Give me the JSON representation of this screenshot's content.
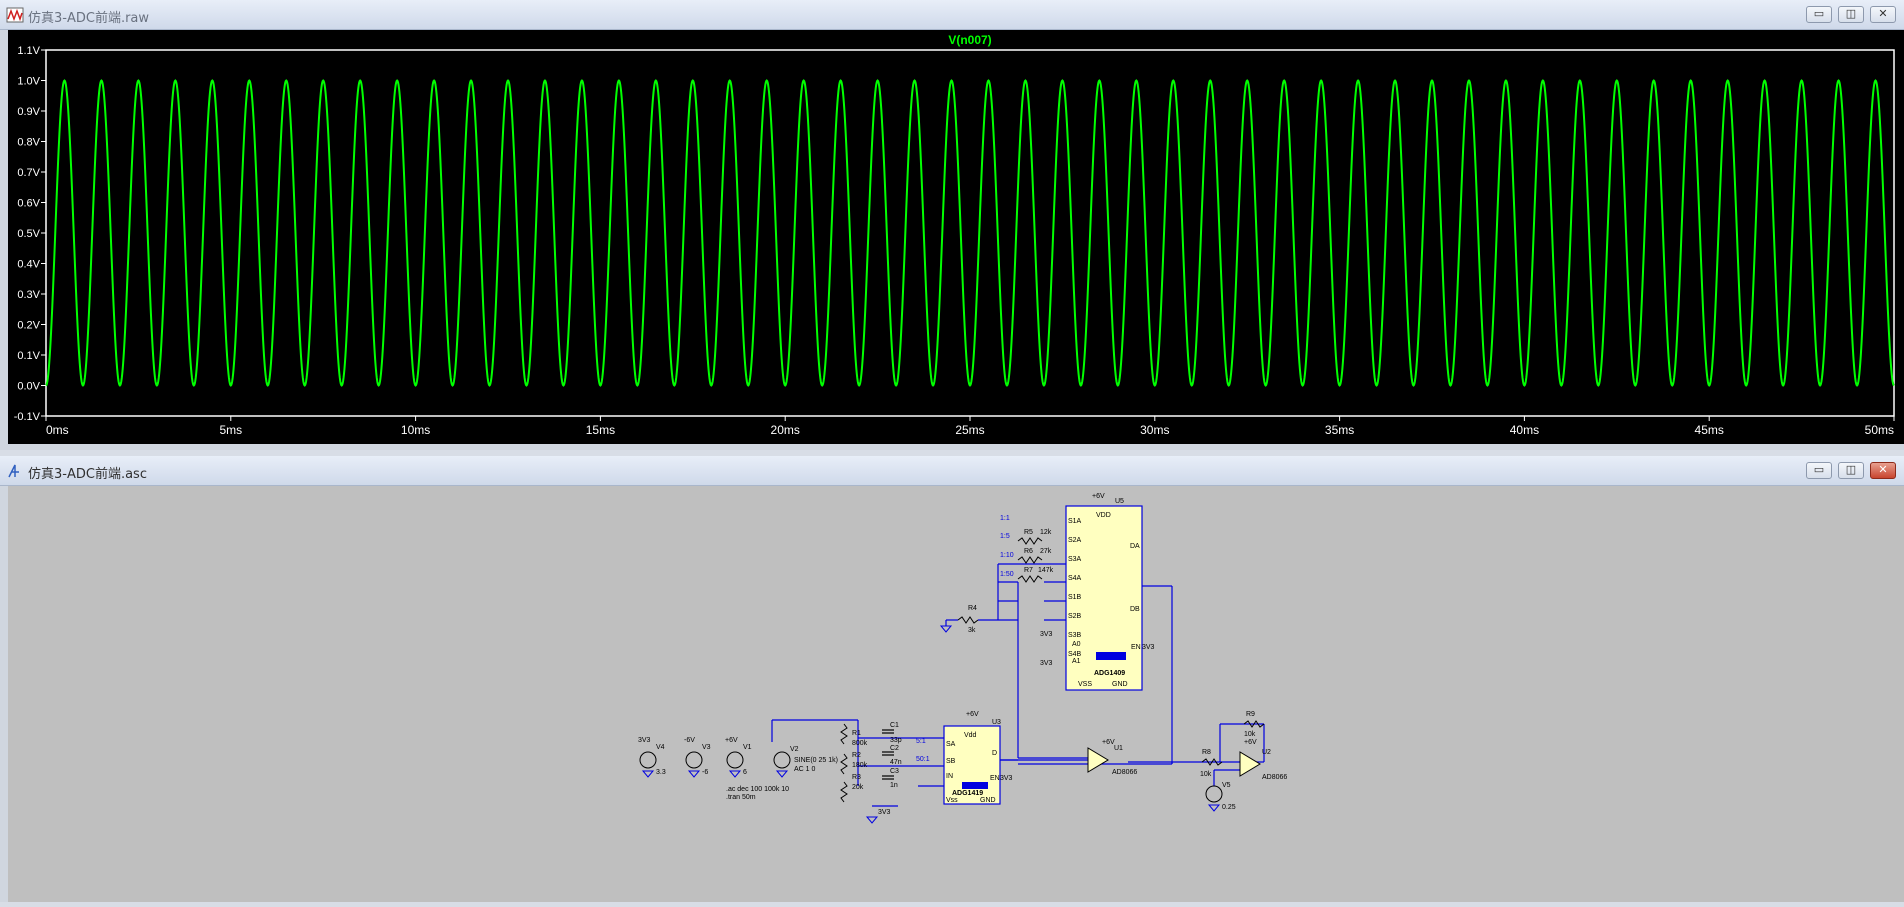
{
  "plot_window": {
    "title": "仿真3-ADC前端.raw",
    "buttons": [
      "▭",
      "◫",
      "✕"
    ]
  },
  "schematic_window": {
    "title": "仿真3-ADC前端.asc",
    "buttons": [
      "▭",
      "◫",
      "✕"
    ]
  },
  "colors": {
    "trace": "#00ff00",
    "wire": "#0000ff",
    "component_fill": "#ffffc0",
    "canvas": "#bfbfbf",
    "plot_bg": "#000000"
  },
  "chart_data": {
    "type": "line",
    "title": "V(n007)",
    "xlim": [
      0,
      50
    ],
    "ylim": [
      -0.1,
      1.1
    ],
    "x_ticks": [
      "0ms",
      "5ms",
      "10ms",
      "15ms",
      "20ms",
      "25ms",
      "30ms",
      "35ms",
      "40ms",
      "45ms",
      "50ms"
    ],
    "y_ticks": [
      "1.1V",
      "1.0V",
      "0.9V",
      "0.8V",
      "0.7V",
      "0.6V",
      "0.5V",
      "0.4V",
      "0.3V",
      "0.2V",
      "0.1V",
      "0.0V",
      "-0.1V"
    ],
    "series": [
      {
        "name": "V(n007)",
        "waveform": "sine",
        "frequency_khz": 1,
        "offset_v": 0.5,
        "amplitude_v": 0.5
      }
    ]
  },
  "schematic": {
    "components": {
      "U5": {
        "ref": "U5",
        "part": "ADG1409",
        "vdd": "VDD",
        "vss": "VSS",
        "gnd": "GND",
        "da": "DA",
        "db": "DB",
        "en": "EN",
        "en_net": "3V3",
        "a0": "A0",
        "a1": "A1",
        "a0_net": "3V3",
        "a1_net": "3V3",
        "supply": "+6V",
        "pins_a": [
          "S1A",
          "S2A",
          "S3A",
          "S4A"
        ],
        "pins_b": [
          "S1B",
          "S2B",
          "S3B",
          "S4B"
        ]
      },
      "U3": {
        "ref": "U3",
        "part": "ADG1419",
        "vdd": "Vdd",
        "vss": "Vss",
        "gnd": "GND",
        "sa": "SA",
        "sb": "SB",
        "in": "IN",
        "d": "D",
        "en": "EN",
        "en_net": "3V3",
        "supply": "+6V",
        "in_net": "3V3"
      },
      "U1": {
        "ref": "U1",
        "part": "AD8066",
        "supply": "+6V"
      },
      "U2": {
        "ref": "U2",
        "part": "AD8066",
        "supply": "+6V"
      },
      "R4": {
        "ref": "R4",
        "value": "3k"
      },
      "R5": {
        "ref": "R5",
        "value": "12k"
      },
      "R6": {
        "ref": "R6",
        "value": "27k"
      },
      "R7": {
        "ref": "R7",
        "value": "147k"
      },
      "R1": {
        "ref": "R1",
        "value": "800k"
      },
      "R2": {
        "ref": "R2",
        "value": "180k"
      },
      "R3": {
        "ref": "R3",
        "value": "20k"
      },
      "R8": {
        "ref": "R8",
        "value": "10k"
      },
      "R9": {
        "ref": "R9",
        "value": "10k"
      },
      "C1": {
        "ref": "C1",
        "value": "33p"
      },
      "C2": {
        "ref": "C2",
        "value": "47n"
      },
      "C3": {
        "ref": "C3",
        "value": "1n"
      },
      "V1": {
        "ref": "V1",
        "value": "6",
        "net": "+6V"
      },
      "V2": {
        "ref": "V2",
        "value1": "SINE(0 25 1k)",
        "value2": "AC 1 0"
      },
      "V3": {
        "ref": "V3",
        "value": "-6",
        "net": "-6V"
      },
      "V4": {
        "ref": "V4",
        "value": "3.3",
        "net": "3V3"
      },
      "V5": {
        "ref": "V5",
        "value": "0.25"
      }
    },
    "ratio_labels": [
      "1:1",
      "1:5",
      "1:10",
      "1:50"
    ],
    "mux_labels": [
      "5:1",
      "50:1"
    ],
    "directives": [
      ".ac dec 100 100k 10",
      ".tran 50m"
    ],
    "net_3v3": "3V3"
  }
}
